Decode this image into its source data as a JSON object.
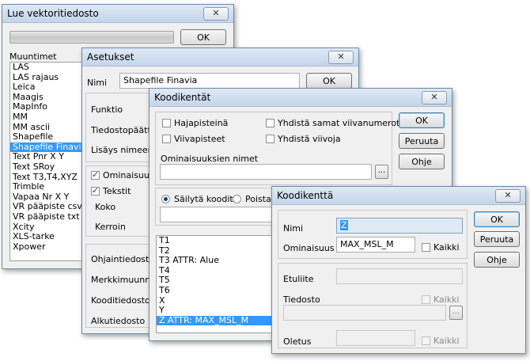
{
  "lue": {
    "title": "Lue vektoritiedosto",
    "close": "✕",
    "ok": "OK",
    "muuntimet_label": "Muuntimet",
    "items": [
      "LAS",
      "LAS rajaus",
      "Leica",
      "Maagis",
      "MapInfo",
      "MM",
      "MM ascii",
      "Shapefile",
      "Shapefile Finavia",
      "Text Pnr X Y",
      "Text SRoy",
      "Text T3,T4,XYZ",
      "Trimble",
      "Vapaa Nr X Y",
      "VR pääpiste csv",
      "VR pääpiste txt",
      "Xcity",
      "XLS-tarke",
      "Xpower"
    ],
    "selected": "Shapefile Finavia"
  },
  "asetukset": {
    "title": "Asetukset",
    "close": "✕",
    "nimi_label": "Nimi",
    "nimi_value": "Shapefile Finavia",
    "ok": "OK",
    "funktio": "Funktio",
    "tiedostopaatteet": "Tiedostopäätte",
    "lisays_nimeen": "Lisäys nimeen",
    "ominaisuus": "Ominaisuus",
    "tekstit": "Tekstit",
    "koko": "Koko",
    "kerroin": "Kerroin",
    "ohjaintiedosto": "Ohjaintiedosto",
    "merkkimuunnos": "Merkkimuunnos",
    "koodi_tiedosto": "Kooditiedosto",
    "alkutiedosto": "Alkutiedosto"
  },
  "koodikentat": {
    "title": "Koodikentät",
    "close": "✕",
    "hajapisteina": "Hajapisteinä",
    "viivapisteet": "Viivapisteet",
    "yhdista_samat": "Yhdistä samat viivanumerot",
    "yhdista_viivoja": "Yhdistä viivoja",
    "ok": "OK",
    "peruuta": "Peruuta",
    "ohje": "Ohje",
    "ominaisuuksien_nimet": "Ominaisuuksien nimet",
    "ellipsis": "...",
    "sailyta": "Säilytä koodit",
    "poista": "Poista k",
    "codes": [
      "T1",
      "T2",
      "T3  ATTR: Alue",
      "T4",
      "T5",
      "T6",
      "X",
      "Y",
      "Z  ATTR: MAX_MSL_M"
    ],
    "selected_code": "Z  ATTR: MAX_MSL_M"
  },
  "koodikentta": {
    "title": "Koodikenttä",
    "close": "✕",
    "nimi_label": "Nimi",
    "nimi_value": "Z",
    "ominaisuus_label": "Ominaisuus",
    "ominaisuus_value": "MAX_MSL_M",
    "kaikki": "Kaikki",
    "ok": "OK",
    "peruuta": "Peruuta",
    "ohje": "Ohje",
    "etuliite": "Etuliite",
    "tiedosto": "Tiedosto",
    "oletus": "Oletus",
    "ellipsis": "..."
  }
}
